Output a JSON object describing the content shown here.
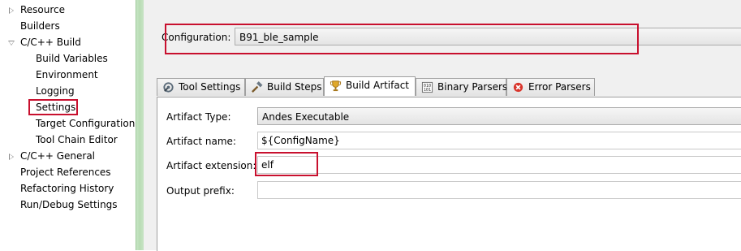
{
  "tree": {
    "items": [
      {
        "label": "Resource",
        "expandable": true
      },
      {
        "label": "Builders",
        "expandable": false
      },
      {
        "label": "C/C++ Build",
        "expandable": true,
        "expanded": true
      },
      {
        "label": "Build Variables",
        "expandable": false
      },
      {
        "label": "Environment",
        "expandable": false
      },
      {
        "label": "Logging",
        "expandable": false
      },
      {
        "label": "Settings",
        "expandable": false,
        "selected": true
      },
      {
        "label": "Target Configuration",
        "expandable": false
      },
      {
        "label": "Tool Chain Editor",
        "expandable": false
      },
      {
        "label": "C/C++ General",
        "expandable": true
      },
      {
        "label": "Project References",
        "expandable": false
      },
      {
        "label": "Refactoring History",
        "expandable": false
      },
      {
        "label": "Run/Debug Settings",
        "expandable": false
      }
    ]
  },
  "configuration": {
    "label": "Configuration:",
    "value": "B91_ble_sample"
  },
  "tabs": [
    {
      "label": "Tool Settings",
      "icon": "wrench-gear-icon"
    },
    {
      "label": "Build Steps",
      "icon": "hammer-icon"
    },
    {
      "label": "Build Artifact",
      "icon": "trophy-icon",
      "active": true
    },
    {
      "label": "Binary Parsers",
      "icon": "binary-icon"
    },
    {
      "label": "Error Parsers",
      "icon": "error-icon"
    }
  ],
  "artifact": {
    "type_label": "Artifact Type:",
    "type_value": "Andes Executable",
    "name_label": "Artifact name:",
    "name_value": "${ConfigName}",
    "extension_label": "Artifact extension:",
    "extension_value": "elf",
    "prefix_label": "Output prefix:",
    "prefix_value": ""
  },
  "colors": {
    "highlight": "#c8102e",
    "sash": "#b8dcb4"
  }
}
